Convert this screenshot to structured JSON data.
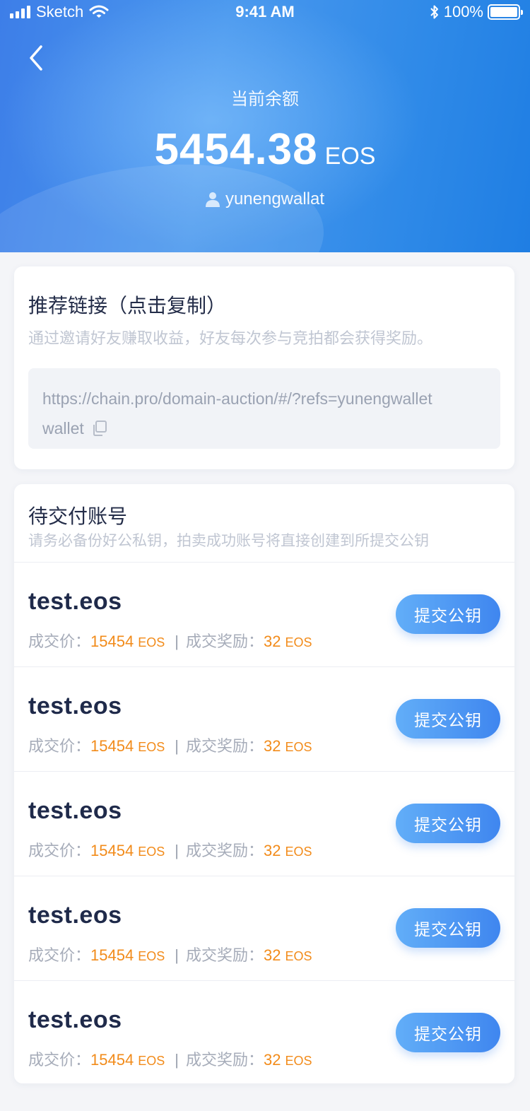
{
  "status_bar": {
    "carrier": "Sketch",
    "time": "9:41 AM",
    "battery": "100%"
  },
  "header": {
    "balance_label": "当前余额",
    "balance_amount": "5454.38",
    "balance_unit": "EOS",
    "account_name": "yunengwallat"
  },
  "referral": {
    "title": "推荐链接（点击复制）",
    "subtitle": "通过邀请好友赚取收益，好友每次参与竞拍都会获得奖励。",
    "link_line1": "https://chain.pro/domain-auction/#/?refs=yunengwallet",
    "link_line2": "wallet"
  },
  "pending": {
    "title": "待交付账号",
    "subtitle": "请务必备份好公私钥，拍卖成功账号将直接创建到所提交公钥",
    "price_label": "成交价：",
    "reward_label": "成交奖励：",
    "separator": "|",
    "button_label": "提交公钥",
    "items": [
      {
        "name": "test.eos",
        "price": "15454",
        "price_unit": "EOS",
        "reward": "32",
        "reward_unit": "EOS"
      },
      {
        "name": "test.eos",
        "price": "15454",
        "price_unit": "EOS",
        "reward": "32",
        "reward_unit": "EOS"
      },
      {
        "name": "test.eos",
        "price": "15454",
        "price_unit": "EOS",
        "reward": "32",
        "reward_unit": "EOS"
      },
      {
        "name": "test.eos",
        "price": "15454",
        "price_unit": "EOS",
        "reward": "32",
        "reward_unit": "EOS"
      },
      {
        "name": "test.eos",
        "price": "15454",
        "price_unit": "EOS",
        "reward": "32",
        "reward_unit": "EOS"
      }
    ]
  },
  "icons": {
    "back": "chevron-left-icon",
    "user": "user-icon",
    "copy": "copy-icon",
    "wifi": "wifi-icon",
    "signal": "signal-icon",
    "bluetooth": "bluetooth-icon",
    "battery": "battery-icon"
  },
  "colors": {
    "header_start": "#3d7ee8",
    "header_end": "#1f7ee3",
    "accent_orange": "#f28b1a",
    "button_start": "#62aef8",
    "button_end": "#3f86ef",
    "title_dark": "#1f2a4a"
  }
}
